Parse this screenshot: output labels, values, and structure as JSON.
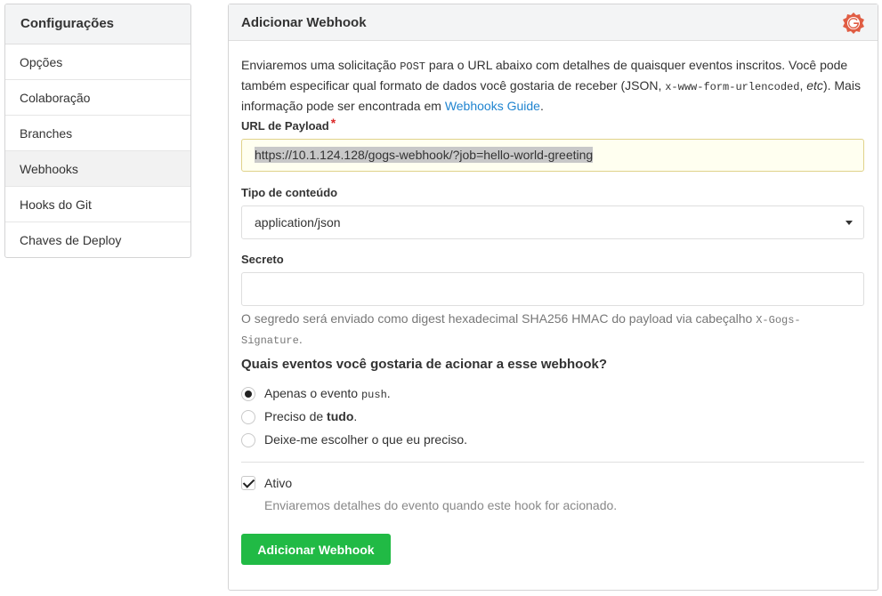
{
  "sidebar": {
    "title": "Configurações",
    "items": [
      {
        "label": "Opções"
      },
      {
        "label": "Colaboração"
      },
      {
        "label": "Branches"
      },
      {
        "label": "Webhooks"
      },
      {
        "label": "Hooks do Git"
      },
      {
        "label": "Chaves de Deploy"
      }
    ]
  },
  "panel": {
    "title": "Adicionar Webhook",
    "intro": {
      "part1": "Enviaremos uma solicitação ",
      "post": "POST",
      "part2": " para o URL abaixo com detalhes de quaisquer eventos inscritos. Você pode também especificar qual formato de dados você gostaria de receber (JSON, ",
      "format": "x-www-form-urlencoded",
      "part3": ", ",
      "etc": "etc",
      "part4": "). Mais informação pode ser encontrada em ",
      "link": "Webhooks Guide",
      "part5": "."
    },
    "payload_label": "URL de Payload",
    "required_mark": "*",
    "payload_url": "https://10.1.124.128/gogs-webhook/?job=hello-world-greeting",
    "content_type_label": "Tipo de conteúdo",
    "content_type_value": "application/json",
    "secret_label": "Secreto",
    "secret_value": "",
    "secret_help": {
      "part1": "O segredo será enviado como digest hexadecimal SHA256 HMAC do payload via cabeçalho ",
      "header1": "X-Gogs-",
      "header2": "Signature",
      "part2": "."
    },
    "events_question": "Quais eventos você gostaria de acionar a esse webhook?",
    "event_options": {
      "push_only": {
        "prefix": "Apenas o evento ",
        "code": "push",
        "suffix": "."
      },
      "everything": {
        "prefix": "Preciso de ",
        "bold": "tudo",
        "suffix": "."
      },
      "choose": {
        "label": "Deixe-me escolher o que eu preciso."
      }
    },
    "selected_event": "push_only",
    "active_label": "Ativo",
    "active_checked": true,
    "active_help": "Enviaremos detalhes do evento quando este hook for acionado.",
    "submit_label": "Adicionar Webhook"
  },
  "colors": {
    "accent_green": "#21ba45",
    "link_blue": "#2185d0",
    "required_red": "#db2828",
    "logo_red": "#e05d44"
  },
  "icons": {
    "logo": "gogs-logo-icon",
    "dropdown": "dropdown-caret-icon"
  }
}
